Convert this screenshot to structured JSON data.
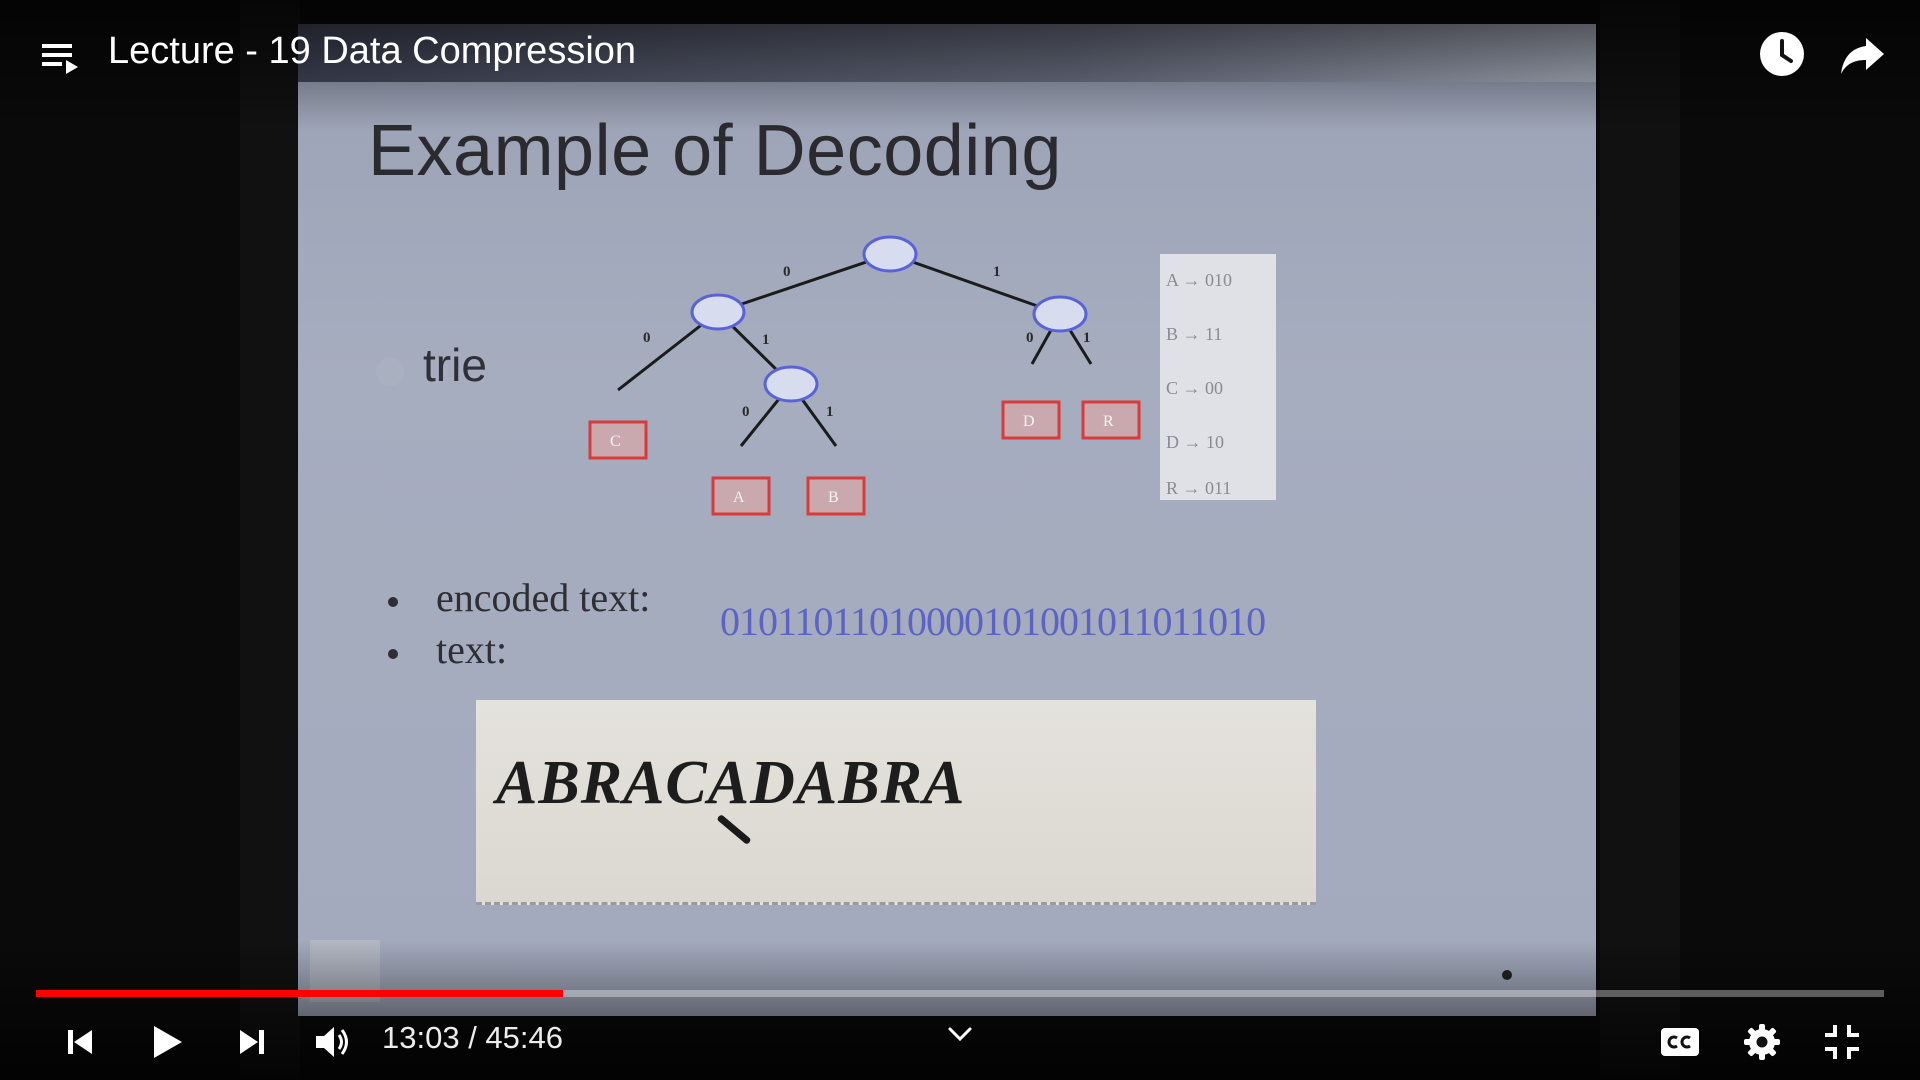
{
  "player": {
    "title": "Lecture - 19 Data Compression",
    "time_current": "13:03",
    "time_separator": " / ",
    "time_total": "45:46",
    "progress_fraction": 0.285,
    "accent": "#ff0000"
  },
  "slide": {
    "title": "Example of Decoding",
    "trie_label": "trie",
    "tree": {
      "edge_labels": [
        "0",
        "1",
        "0",
        "1",
        "0",
        "1",
        "0",
        "1"
      ],
      "leaves": [
        "C",
        "A",
        "B",
        "D",
        "R"
      ]
    },
    "code_table": [
      "A → 010",
      "B → 11",
      "C → 00",
      "D → 10",
      "R → 011"
    ],
    "bullets": [
      {
        "label": "encoded text:",
        "value": "01011011010000101001011011010"
      },
      {
        "label": "text:",
        "value": ""
      }
    ],
    "answer": "ABRACADABRA"
  },
  "icons": {
    "playlist": "playlist-icon",
    "watch_later": "clock-icon",
    "share": "share-icon",
    "prev": "skip-previous-icon",
    "play": "play-icon",
    "next": "skip-next-icon",
    "volume": "volume-icon",
    "chevron": "chevron-down-icon",
    "captions": "cc-icon",
    "settings": "gear-icon",
    "exit_fullscreen": "exit-fullscreen-icon"
  }
}
